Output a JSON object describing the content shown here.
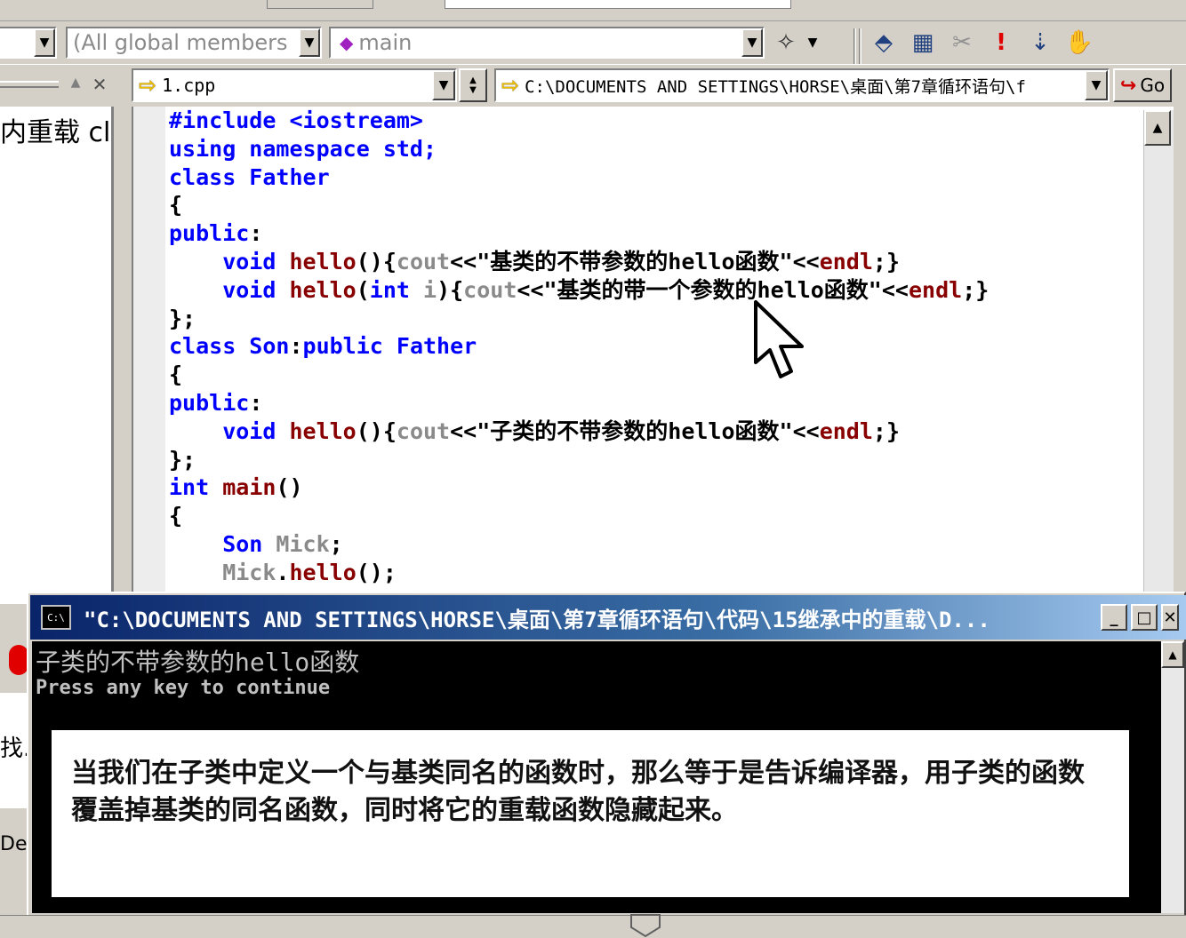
{
  "toolbar": {
    "members_combo": "(All global members",
    "function_combo": "main",
    "function_icon": "diamond-icon"
  },
  "editor": {
    "file_combo": "1.cpp",
    "path_combo": "C:\\DOCUMENTS AND SETTINGS\\HORSE\\桌面\\第7章循环语句\\f",
    "go_label": "Go",
    "code": [
      [
        {
          "t": "#include <iostream>",
          "c": "kw"
        }
      ],
      [
        {
          "t": "using namespace std;",
          "c": "kw"
        }
      ],
      [
        {
          "t": "class Father",
          "c": "kw"
        }
      ],
      [
        {
          "t": "{",
          "c": ""
        }
      ],
      [
        {
          "t": "public",
          "c": "kw"
        },
        {
          "t": ":",
          "c": ""
        }
      ],
      [
        {
          "t": "    void ",
          "c": "kw"
        },
        {
          "t": "hello",
          "c": "fn"
        },
        {
          "t": "(){",
          "c": ""
        },
        {
          "t": "cout",
          "c": "gr"
        },
        {
          "t": "<<\"基类的不带参数的hello函数\"<<",
          "c": ""
        },
        {
          "t": "endl",
          "c": "fn"
        },
        {
          "t": ";}",
          "c": ""
        }
      ],
      [
        {
          "t": "    void ",
          "c": "kw"
        },
        {
          "t": "hello",
          "c": "fn"
        },
        {
          "t": "(",
          "c": ""
        },
        {
          "t": "int",
          "c": "kw"
        },
        {
          "t": " i",
          "c": "gr"
        },
        {
          "t": "){",
          "c": ""
        },
        {
          "t": "cout",
          "c": "gr"
        },
        {
          "t": "<<\"基类的带一个参数的hello函数\"<<",
          "c": ""
        },
        {
          "t": "endl",
          "c": "fn"
        },
        {
          "t": ";}",
          "c": ""
        }
      ],
      [
        {
          "t": "};",
          "c": ""
        }
      ],
      [
        {
          "t": "class Son",
          "c": "kw"
        },
        {
          "t": ":",
          "c": ""
        },
        {
          "t": "public Father",
          "c": "kw"
        }
      ],
      [
        {
          "t": "{",
          "c": ""
        }
      ],
      [
        {
          "t": "public",
          "c": "kw"
        },
        {
          "t": ":",
          "c": ""
        }
      ],
      [
        {
          "t": "    void ",
          "c": "kw"
        },
        {
          "t": "hello",
          "c": "fn"
        },
        {
          "t": "(){",
          "c": ""
        },
        {
          "t": "cout",
          "c": "gr"
        },
        {
          "t": "<<\"子类的不带参数的hello函数\"<<",
          "c": ""
        },
        {
          "t": "endl",
          "c": "fn"
        },
        {
          "t": ";}",
          "c": ""
        }
      ],
      [
        {
          "t": "};",
          "c": ""
        }
      ],
      [
        {
          "t": "int ",
          "c": "kw"
        },
        {
          "t": "main",
          "c": "fn"
        },
        {
          "t": "()",
          "c": ""
        }
      ],
      [
        {
          "t": "{",
          "c": ""
        }
      ],
      [
        {
          "t": "    Son ",
          "c": "kw"
        },
        {
          "t": "Mick",
          "c": "gr"
        },
        {
          "t": ";",
          "c": ""
        }
      ],
      [
        {
          "t": "    Mick",
          "c": "gr"
        },
        {
          "t": ".",
          "c": ""
        },
        {
          "t": "hello",
          "c": "fn"
        },
        {
          "t": "();",
          "c": ""
        }
      ]
    ]
  },
  "left_panel": {
    "text": "内重载 cl",
    "frag1": "找.",
    "frag2": "Del"
  },
  "console": {
    "title": "\"C:\\DOCUMENTS AND SETTINGS\\HORSE\\桌面\\第7章循环语句\\代码\\15继承中的重载\\D...",
    "icon_text": "C:\\",
    "output_line1": "子类的不带参数的hello函数",
    "output_line2": "Press any key to continue"
  },
  "note": {
    "text": "当我们在子类中定义一个与基类同名的函数时，那么等于是告诉编译器，用子类的函数覆盖掉基类的同名函数，同时将它的重载函数隐藏起来。"
  },
  "colors": {
    "keyword": "#0000ff",
    "function": "#880000",
    "identifier": "#8a8a8a",
    "titlebar": "#0a246a"
  }
}
